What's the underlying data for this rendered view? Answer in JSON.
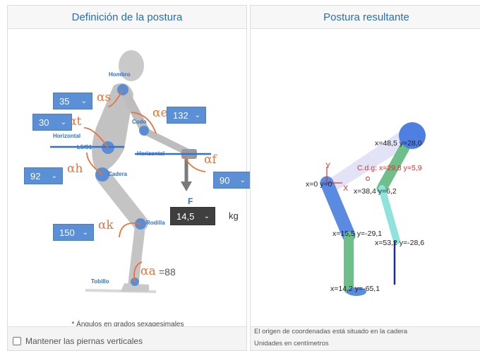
{
  "left_panel": {
    "title": "Definición de la postura",
    "note": "* Ángulos en grados sexagesimales",
    "checkbox_label": "Mantener las piernas verticales",
    "body_labels": {
      "hombro": "Hombro",
      "codo": "Codo",
      "horizontal_1": "Horizontal",
      "l5s1": "L5/S1",
      "horizontal_2": "Horizontal",
      "cadera": "Cadera",
      "rodilla": "Rodilla",
      "tobillo": "Tobillo",
      "force": "F"
    },
    "angles": {
      "s": {
        "symbol": "αs",
        "value": "35"
      },
      "t": {
        "symbol": "αt",
        "value": "30"
      },
      "e": {
        "symbol": "αe",
        "value": "132"
      },
      "f": {
        "symbol": "αf",
        "value": "90"
      },
      "h": {
        "symbol": "αh",
        "value": "92"
      },
      "k": {
        "symbol": "αk",
        "value": "150"
      },
      "a": {
        "symbol": "αa",
        "value": "=88"
      }
    },
    "force": {
      "value": "14,5",
      "unit": "kg"
    }
  },
  "right_panel": {
    "title": "Postura resultante",
    "foot_line1": "El origen de coordenadas está situado en la cadera",
    "foot_line2": "Unidades en centímetros",
    "axis_y": "Y",
    "axis_x": "X",
    "coords": {
      "hand": "x=48,5 y=28,0",
      "cog": "C.d.g: x=29,8 y=5,9",
      "origin": "x=0 y=0",
      "elbow": "x=38,4 y=6,2",
      "knee": "x=15,5 y=-29,1",
      "load": "x=53,2 y=-28,6",
      "ankle": "x=14,2 y=-65,1"
    }
  },
  "colors": {
    "accent": "#2a6db5",
    "select_bg": "#5b8fd6",
    "angle": "#e8733a",
    "torso": "#5b8be0",
    "thigh": "#6fbf8a",
    "forearm": "#8ee3dc",
    "head": "#4f7fe0",
    "cog": "#d23434",
    "load": "#1a2d9a"
  }
}
